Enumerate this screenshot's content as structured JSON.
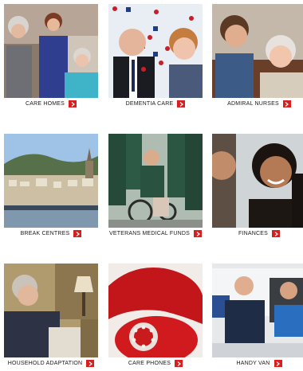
{
  "services": [
    {
      "label": "CARE HOMES",
      "image": "care-homes-photo"
    },
    {
      "label": "DEMENTIA CARE",
      "image": "dementia-care-photo"
    },
    {
      "label": "ADMIRAL NURSES",
      "image": "admiral-nurses-photo"
    },
    {
      "label": "BREAK CENTRES",
      "image": "break-centres-photo"
    },
    {
      "label": "VETERANS MEDICAL FUNDS",
      "image": "veterans-medical-funds-photo"
    },
    {
      "label": "FINANCES",
      "image": "finances-photo"
    },
    {
      "label": "HOUSEHOLD ADAPTATION",
      "image": "household-adaptation-photo"
    },
    {
      "label": "CARE PHONES",
      "image": "care-phones-photo"
    },
    {
      "label": "HANDY VAN",
      "image": "handy-van-photo"
    }
  ],
  "colors": {
    "accent": "#d81e1e",
    "text": "#1a1a1a",
    "background": "#ffffff"
  },
  "icons": {
    "arrow": "chevron-right-icon"
  }
}
